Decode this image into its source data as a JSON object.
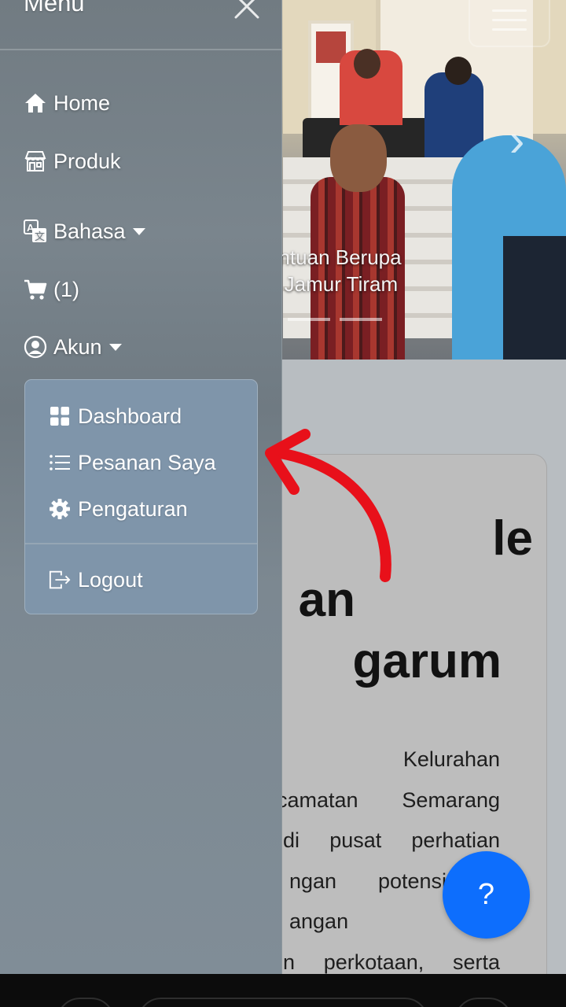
{
  "drawer": {
    "title": "Menu",
    "close_icon": "close-icon",
    "nav": [
      {
        "label": "Home",
        "icon": "home-icon"
      },
      {
        "label": "Produk",
        "icon": "shop-icon"
      },
      {
        "label": "Bahasa",
        "icon": "translate-icon",
        "dropdown": true
      },
      {
        "label": "(1)",
        "icon": "cart-icon"
      },
      {
        "label": "Akun",
        "icon": "user-circle-icon",
        "dropdown": true
      }
    ],
    "account_menu": {
      "items": [
        {
          "label": "Dashboard",
          "icon": "grid-icon"
        },
        {
          "label": "Pesanan Saya",
          "icon": "list-icon"
        },
        {
          "label": "Pengaturan",
          "icon": "gear-icon"
        }
      ],
      "logout": {
        "label": "Logout",
        "icon": "logout-icon"
      }
    }
  },
  "background": {
    "carousel": {
      "caption_line1": "antuan Berupa",
      "caption_line2": "n Jamur Tiram",
      "indicator_count": 2
    },
    "article": {
      "title_lines": [
        "le",
        "an",
        "garum"
      ],
      "body_lines": [
        "-  Kelurahan",
        "camatan  Semarang",
        "di  pusat  perhatian",
        "ngan potensi b",
        "angan  budi",
        "n  perkotaan,  serta"
      ]
    }
  },
  "help_button": {
    "label": "?"
  },
  "colors": {
    "fab": "#0d6efd",
    "annotation_arrow": "#e8101a",
    "drawer_overlay": "#7a858d",
    "dropdown_bg": "#7f95aa"
  }
}
